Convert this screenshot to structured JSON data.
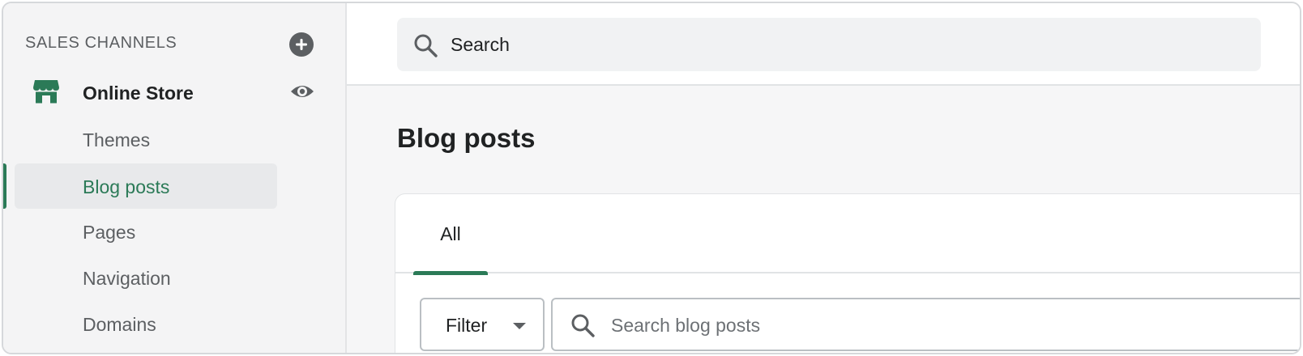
{
  "colors": {
    "accent": "#2b7a57",
    "sidebar_bg": "#f4f4f5",
    "page_bg": "#f6f6f7",
    "muted_text": "#5c5f62"
  },
  "sidebar": {
    "section_title": "SALES CHANNELS",
    "add_icon": "plus-circle-icon",
    "channel": {
      "label": "Online Store",
      "icon": "store-icon",
      "view_icon": "eye-icon"
    },
    "items": [
      {
        "label": "Themes",
        "active": false
      },
      {
        "label": "Blog posts",
        "active": true
      },
      {
        "label": "Pages",
        "active": false
      },
      {
        "label": "Navigation",
        "active": false
      },
      {
        "label": "Domains",
        "active": false
      }
    ]
  },
  "topbar": {
    "search_text": "Search",
    "search_icon": "search-icon"
  },
  "main": {
    "title": "Blog posts",
    "tabs": [
      {
        "label": "All",
        "selected": true
      }
    ],
    "filter_label": "Filter",
    "filter_icon": "caret-down-icon",
    "search_placeholder": "Search blog posts",
    "search_icon": "search-icon"
  }
}
